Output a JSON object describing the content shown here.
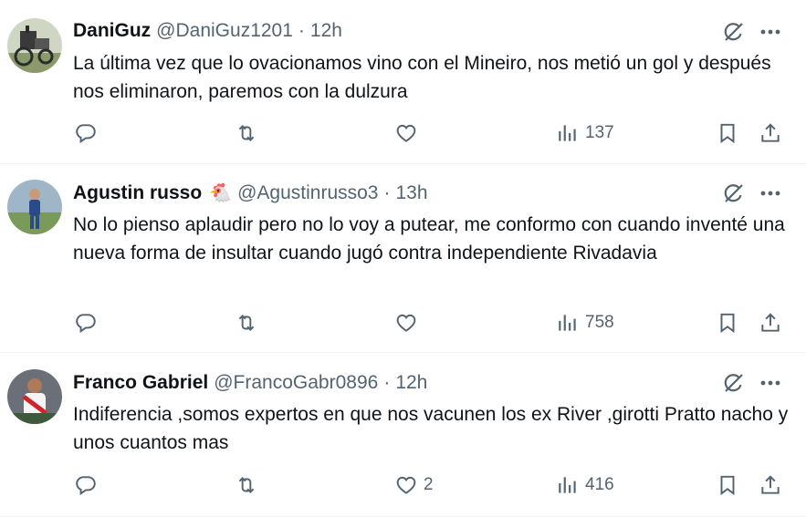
{
  "tweets": [
    {
      "name": "DaniGuz",
      "emoji": "",
      "handle": "@DaniGuz1201",
      "dot": "·",
      "time": "12h",
      "text": "La última vez que lo ovacionamos vino con el Mineiro, nos metió un gol y después nos eliminaron, paremos con la dulzura",
      "likes": "",
      "views": "137"
    },
    {
      "name": "Agustin russo",
      "emoji": "🐔",
      "handle": "@Agustinrusso3",
      "dot": "·",
      "time": "13h",
      "text": "No lo pienso aplaudir pero no lo voy a putear, me conformo con cuando inventé una nueva forma de insultar cuando jugó contra independiente Rivadavia",
      "likes": "",
      "views": "758"
    },
    {
      "name": "Franco Gabriel",
      "emoji": "",
      "handle": "@FrancoGabr0896",
      "dot": "·",
      "time": "12h",
      "text": "Indiferencia ,somos expertos en que nos vacunen los ex River ,girotti Pratto nacho y unos cuantos mas",
      "likes": "2",
      "views": "416"
    }
  ],
  "icons": {
    "reply": "reply-icon",
    "retweet": "retweet-icon",
    "like": "heart-icon",
    "views": "views-icon",
    "bookmark": "bookmark-icon",
    "share": "share-icon",
    "grok": "grok-icon",
    "more": "more-icon"
  },
  "colors": {
    "text": "#0f1419",
    "secondary": "#536471",
    "divider": "#eff3f4"
  }
}
